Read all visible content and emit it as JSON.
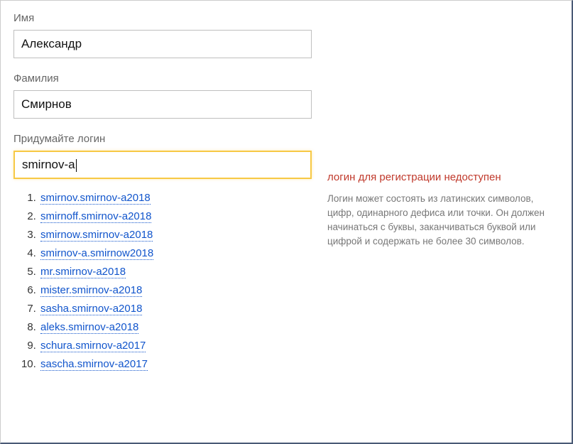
{
  "fields": {
    "firstName": {
      "label": "Имя",
      "value": "Александр"
    },
    "lastName": {
      "label": "Фамилия",
      "value": "Смирнов"
    },
    "login": {
      "label": "Придумайте логин",
      "value": "smirnov-a"
    }
  },
  "suggestions": [
    "smirnov.smirnov-a2018",
    "smirnoff.smirnov-a2018",
    "smirnow.smirnov-a2018",
    "smirnov-a.smirnow2018",
    "mr.smirnov-a2018",
    "mister.smirnov-a2018",
    "sasha.smirnov-a2018",
    "aleks.smirnov-a2018",
    "schura.smirnov-a2017",
    "sascha.smirnov-a2017"
  ],
  "error": {
    "title": "логин для регистрации недоступен",
    "hint": "Логин может состоять из латинских символов, цифр, одинарного дефиса или точки. Он должен начинаться с буквы, заканчиваться буквой или цифрой и содержать не более 30 символов."
  }
}
